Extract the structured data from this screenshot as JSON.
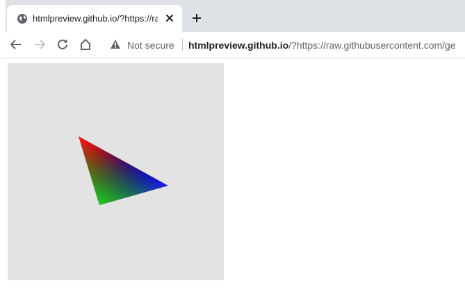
{
  "tab": {
    "title": "htmlpreview.github.io/?https://ra",
    "favicon": "globe-icon",
    "close": "close-icon"
  },
  "new_tab": {
    "icon": "plus-icon"
  },
  "toolbar": {
    "back": "back-arrow-icon",
    "forward": "forward-arrow-icon",
    "reload": "reload-icon",
    "home": "home-icon"
  },
  "omnibox": {
    "security_icon": "warning-triangle-icon",
    "security_label": "Not secure",
    "url_host": "htmlpreview.github.io",
    "url_rest": "/?https://raw.githubusercontent.com/ge"
  },
  "page": {
    "canvas_bg": "#e3e3e3",
    "triangle_colors": [
      "#ff1a1a",
      "#1a1aff",
      "#22cc22"
    ]
  }
}
